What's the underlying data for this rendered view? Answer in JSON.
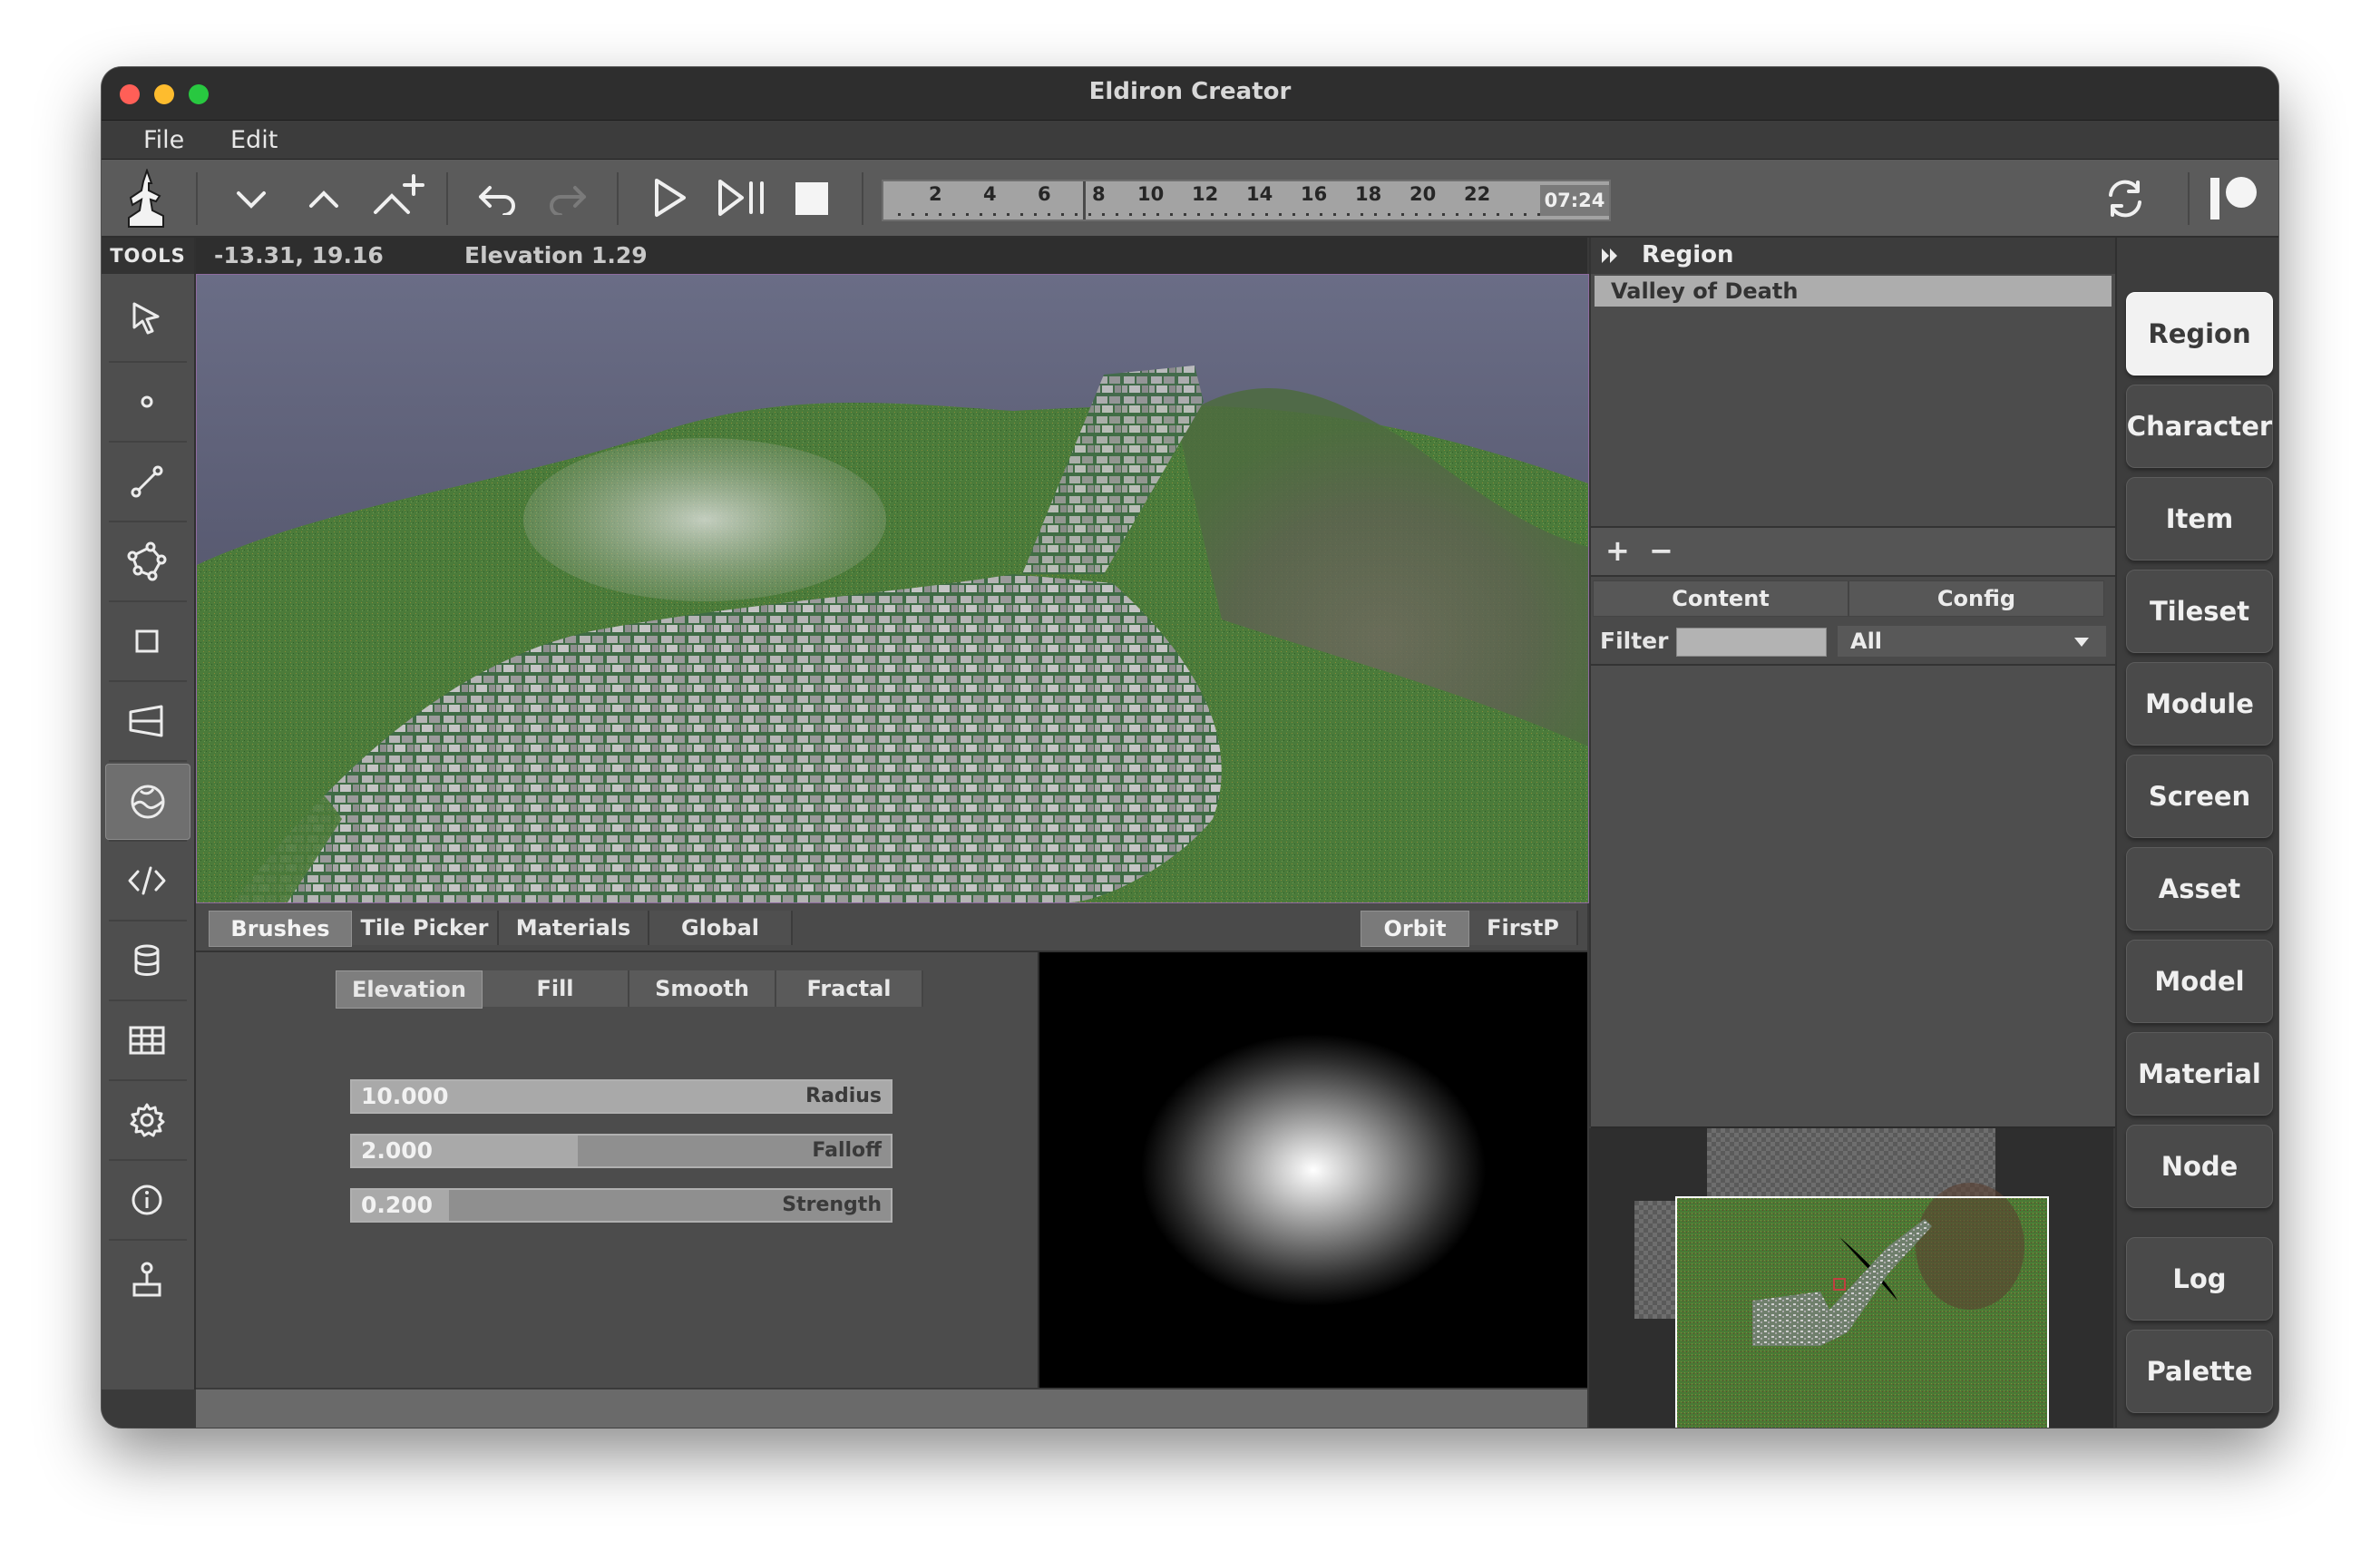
{
  "app": {
    "title": "Eldiron Creator"
  },
  "menu": {
    "file": "File",
    "edit": "Edit"
  },
  "toolbar": {
    "timeline": {
      "ticks": [
        "2",
        "4",
        "6",
        "8",
        "10",
        "12",
        "14",
        "16",
        "18",
        "20",
        "22"
      ],
      "time": "07:24"
    }
  },
  "tools": {
    "header": "TOOLS",
    "items": [
      {
        "name": "select-tool",
        "icon": "cursor-icon"
      },
      {
        "name": "vertex-tool",
        "icon": "dot-icon"
      },
      {
        "name": "linedef-tool",
        "icon": "line-icon"
      },
      {
        "name": "sector-tool",
        "icon": "polygon-icon"
      },
      {
        "name": "rect-tool",
        "icon": "square-icon"
      },
      {
        "name": "tileset-tool",
        "icon": "perspective-icon"
      },
      {
        "name": "terrain-tool",
        "icon": "terrain-icon",
        "active": true
      },
      {
        "name": "code-tool",
        "icon": "code-icon"
      },
      {
        "name": "data-tool",
        "icon": "database-icon"
      },
      {
        "name": "grid-tool",
        "icon": "grid-icon"
      },
      {
        "name": "settings-tool",
        "icon": "gear-icon"
      },
      {
        "name": "info-tool",
        "icon": "info-icon"
      },
      {
        "name": "game-tool",
        "icon": "joystick-icon"
      }
    ]
  },
  "status": {
    "coords": "-13.31, 19.16",
    "elevation": "Elevation 1.29"
  },
  "bottom_tabs": {
    "left": [
      "Brushes",
      "Tile Picker",
      "Materials",
      "Global"
    ],
    "right": [
      "Orbit",
      "FirstP"
    ]
  },
  "brush": {
    "modes": [
      "Elevation",
      "Fill",
      "Smooth",
      "Fractal"
    ],
    "sliders": [
      {
        "value": "10.000",
        "label": "Radius",
        "fill": 1.0
      },
      {
        "value": "2.000",
        "label": "Falloff",
        "fill": 0.42
      },
      {
        "value": "0.200",
        "label": "Strength",
        "fill": 0.18
      }
    ]
  },
  "region": {
    "header": "Region",
    "items": [
      "Valley of Death"
    ],
    "add": "+",
    "remove": "−",
    "tabs": [
      "Content",
      "Config"
    ],
    "filter_label": "Filter",
    "filter_value": "",
    "filter_option": "All"
  },
  "nav": {
    "items": [
      "Region",
      "Character",
      "Item",
      "Tileset",
      "Module",
      "Screen",
      "Asset",
      "Model",
      "Material",
      "Node",
      "Log",
      "Palette"
    ],
    "active": "Region"
  },
  "colors": {
    "grass": "#4e7d3c",
    "stone": "#b7b7b7",
    "accent_border": "#8f6ba0"
  }
}
